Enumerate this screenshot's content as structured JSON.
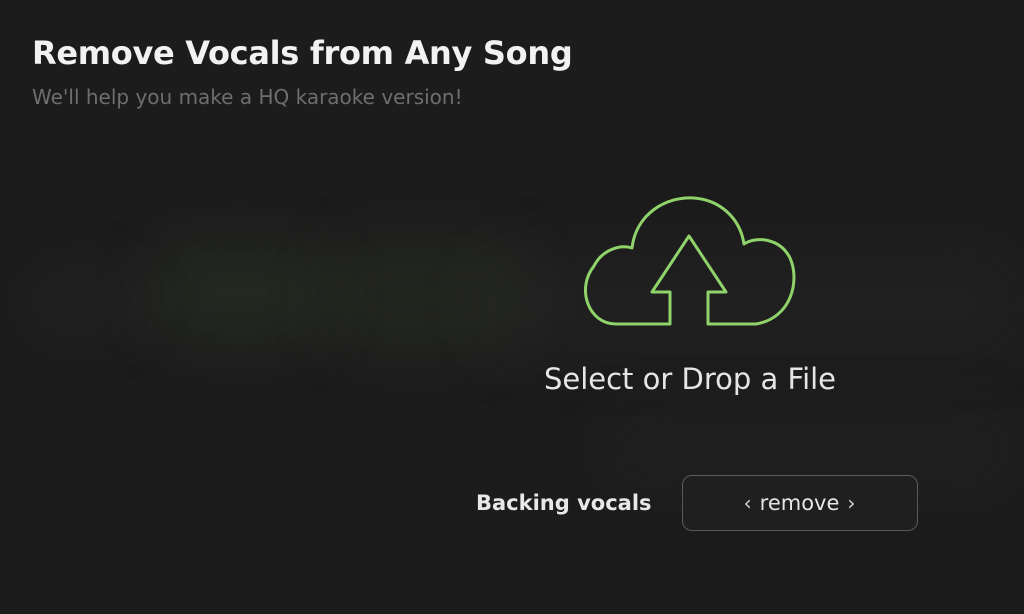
{
  "header": {
    "title": "Remove Vocals from Any Song",
    "subtitle": "We'll help you make a HQ karaoke version!"
  },
  "dropzone": {
    "icon": "cloud-upload-icon",
    "label": "Select or Drop a File",
    "accent_color": "#8fd36a"
  },
  "options": {
    "backing_vocals": {
      "label": "Backing vocals",
      "value": "remove",
      "prev_glyph": "‹",
      "next_glyph": "›"
    }
  },
  "colors": {
    "background": "#1c1c1d",
    "title": "#f2f2f2",
    "subtitle": "#6e6e70",
    "accent": "#8fd36a"
  }
}
